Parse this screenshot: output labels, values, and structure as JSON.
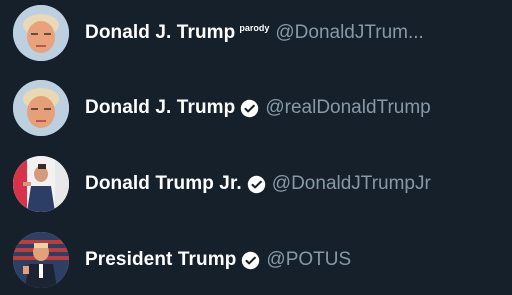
{
  "accounts": [
    {
      "name": "Donald J. Trump",
      "badge": "parody",
      "handle": "@DonaldJTrum...",
      "verified": false,
      "avatar": "avatar-photo-portrait"
    },
    {
      "name": "Donald J. Trump",
      "badge": "",
      "handle": "@realDonaldTrump",
      "verified": true,
      "avatar": "avatar-photo-portrait"
    },
    {
      "name": "Donald Trump Jr.",
      "badge": "",
      "handle": "@DonaldJTrumpJr",
      "verified": true,
      "avatar": "avatar-photo-speaking"
    },
    {
      "name": "President Trump",
      "badge": "",
      "handle": "@POTUS",
      "verified": true,
      "avatar": "avatar-photo-flag"
    }
  ],
  "colors": {
    "background": "#15202b",
    "name_text": "#ffffff",
    "handle_text": "#8899a6",
    "verified_badge": "#ffffff"
  }
}
